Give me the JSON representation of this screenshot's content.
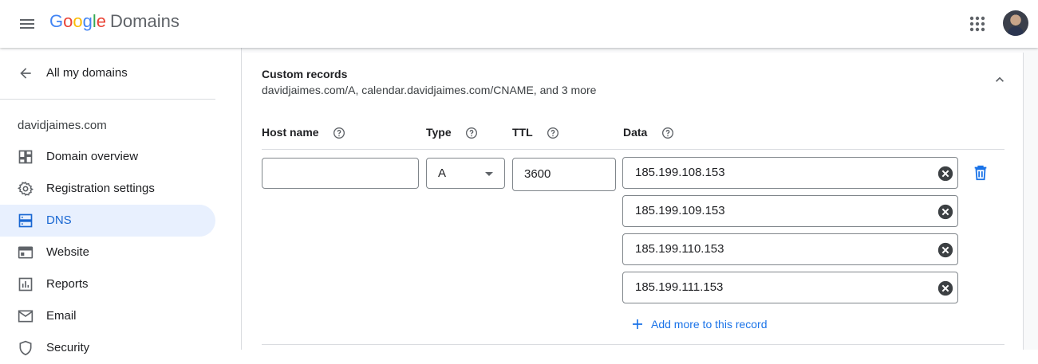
{
  "header": {
    "logo_parts": [
      "G",
      "o",
      "o",
      "g",
      "l",
      "e"
    ],
    "product": "Domains",
    "menu_icon": "hamburger-menu-icon",
    "apps_icon": "apps-grid-icon",
    "avatar_icon": "user-avatar"
  },
  "sidebar": {
    "back_label": "All my domains",
    "domain": "davidjaimes.com",
    "items": [
      {
        "label": "Domain overview",
        "icon": "dashboard-icon"
      },
      {
        "label": "Registration settings",
        "icon": "gear-icon"
      },
      {
        "label": "DNS",
        "icon": "dns-icon",
        "active": true
      },
      {
        "label": "Website",
        "icon": "web-icon"
      },
      {
        "label": "Reports",
        "icon": "bar-chart-icon"
      },
      {
        "label": "Email",
        "icon": "mail-icon"
      },
      {
        "label": "Security",
        "icon": "shield-icon"
      }
    ]
  },
  "custom_records": {
    "title": "Custom records",
    "summary": "davidjaimes.com/A, calendar.davidjaimes.com/CNAME, and 3 more",
    "columns": {
      "host": "Host name",
      "type": "Type",
      "ttl": "TTL",
      "data": "Data"
    },
    "record": {
      "host_value": "",
      "type_value": "A",
      "ttl_value": "3600",
      "data_values": [
        "185.199.108.153",
        "185.199.109.153",
        "185.199.110.153",
        "185.199.111.153"
      ]
    },
    "add_more_label": "Add more to this record"
  },
  "colors": {
    "accent": "#1a73e8",
    "active_bg": "#e8f0fe",
    "active_text": "#1967d2"
  }
}
